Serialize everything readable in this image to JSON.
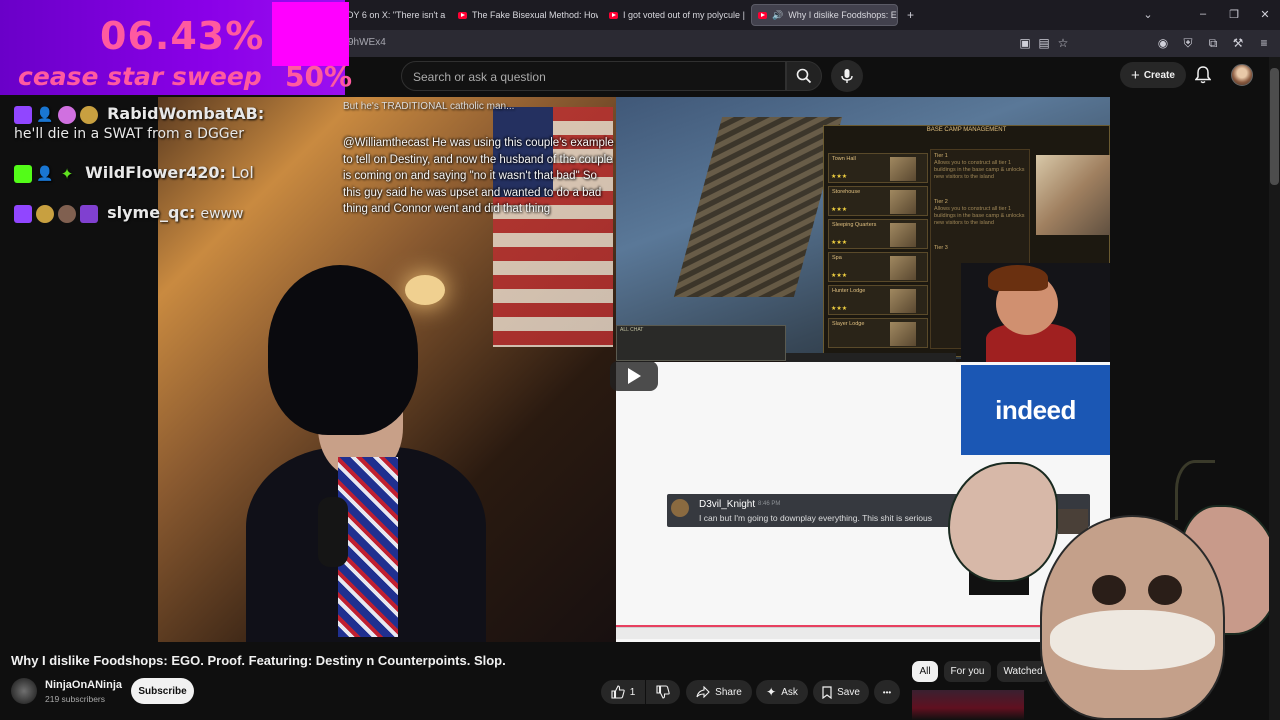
{
  "browser": {
    "tabs": [
      {
        "title": "DY 6 on X: \"There isn't a"
      },
      {
        "title": "The Fake Bisexual Method: How"
      },
      {
        "title": "I got voted out of my polycule |"
      },
      {
        "title": "Why I dislike Foodshops: EG"
      }
    ],
    "url_fragment": "9hWEx4",
    "new_tab_symbol": "+"
  },
  "overlay": {
    "percent_big": "06.43%",
    "cease_text": "cease star sweep",
    "percent_small": "50%"
  },
  "youtube": {
    "search_placeholder": "Search or ask a question",
    "create_label": "Create"
  },
  "chat_overlay": [
    {
      "user": "RabidWombatAB:",
      "message": ""
    },
    {
      "user": "",
      "message": "he'll die in a SWAT from a DGGer"
    },
    {
      "user": "WildFlower420:",
      "message": "Lol"
    },
    {
      "user": "slyme_qc:",
      "message": "ewww"
    }
  ],
  "video": {
    "stream_chat_text": "@Williamthecast He was using this couple's example to tell on Destiny, and now the husband of the couple is coming on and saying \"no it wasn't that bad\" So this guy said he was upset and wanted to do a bad thing and Connor went and did that thing",
    "stream_chat_header": "But he's TRADITIONAL catholic man...",
    "basecamp_title": "BASE CAMP MANAGEMENT",
    "basecamp_rows": [
      {
        "name": "Town Hall"
      },
      {
        "name": "Storehouse"
      },
      {
        "name": "Sleeping Quarters"
      },
      {
        "name": "Spa"
      },
      {
        "name": "Hunter Lodge"
      },
      {
        "name": "Slayer Lodge"
      }
    ],
    "tiers": [
      "Tier 1",
      "Tier 2",
      "Tier 3"
    ],
    "tier_text": "Allows you to construct all tier 1 buildings in the base camp & unlocks new visitors to the island",
    "game_chat_label": "ALL CHAT",
    "indeed_logo": "indeed",
    "discord_user": "D3vil_Knight",
    "discord_time": "8:46 PM",
    "discord_message": "I can but I'm going to downplay everything. This shit is serious"
  },
  "below_video": {
    "title": "Why I dislike Foodshops: EGO. Proof. Featuring: Destiny n Counterpoints. Slop.",
    "channel_name": "NinjaOnANinja",
    "subscribers": "219 subscribers",
    "subscribe_label": "Subscribe",
    "like_count": "1",
    "share_label": "Share",
    "ask_label": "Ask",
    "save_label": "Save",
    "more_label": "•••"
  },
  "filters": [
    {
      "label": "All",
      "active": true
    },
    {
      "label": "For you",
      "active": false
    },
    {
      "label": "Watched",
      "active": false
    }
  ],
  "colors": {
    "youtube_red": "#ff0033",
    "overlay_purple": "#8a00e8",
    "overlay_pink": "#ff00ff",
    "overlay_text": "#ff5aa0",
    "indeed_blue": "#1b57b4"
  }
}
